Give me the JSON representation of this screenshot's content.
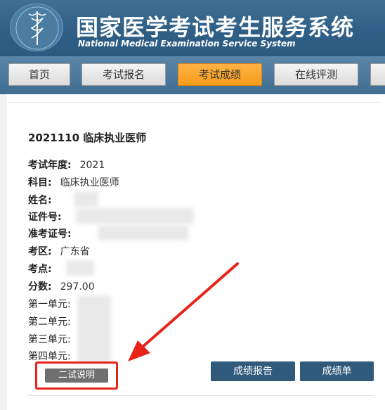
{
  "header": {
    "title_cn": "国家医学考试考生服务系统",
    "title_en": "National Medical Examination Service System"
  },
  "nav": {
    "items": [
      {
        "label": "首页",
        "active": false
      },
      {
        "label": "考试报名",
        "active": false
      },
      {
        "label": "考试成绩",
        "active": true
      },
      {
        "label": "在线评测",
        "active": false
      }
    ]
  },
  "exam": {
    "title": "2021110  临床执业医师",
    "fields": [
      {
        "label": "考试年度:",
        "value": "2021"
      },
      {
        "label": "科目:",
        "value": "临床执业医师"
      },
      {
        "label": "姓名:",
        "value": ""
      },
      {
        "label": "证件号:",
        "value": ""
      },
      {
        "label": "准考证号:",
        "value": ""
      },
      {
        "label": "考区:",
        "value": "广东省"
      },
      {
        "label": "考点:",
        "value": ""
      },
      {
        "label": "分数:",
        "value": "297.00"
      },
      {
        "label": "第一单元:",
        "value": ""
      },
      {
        "label": "第二单元:",
        "value": ""
      },
      {
        "label": "第三单元:",
        "value": ""
      },
      {
        "label": "第四单元:",
        "value": ""
      }
    ]
  },
  "actions": {
    "explain_label": "二试说明",
    "report_label": "成绩报告",
    "sheet_label": "成绩单"
  },
  "colors": {
    "header_blue": "#2f5f86",
    "nav_active": "#f59c1a",
    "button_blue": "#305a7c",
    "annotation_red": "#e8231a"
  }
}
